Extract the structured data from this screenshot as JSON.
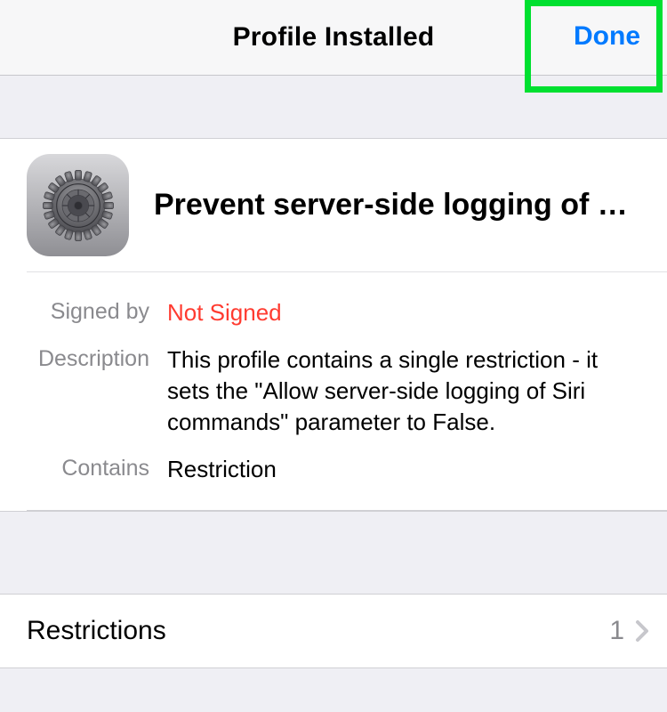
{
  "navbar": {
    "title": "Profile Installed",
    "done_label": "Done"
  },
  "profile": {
    "title": "Prevent server-side logging of Si...",
    "icon_name": "settings-gear-icon"
  },
  "details": {
    "signed_by_label": "Signed by",
    "signed_by_value": "Not Signed",
    "description_label": "Description",
    "description_value": "This profile contains a single restriction - it sets the \"Allow server-side logging of Siri commands\" parameter to False.",
    "contains_label": "Contains",
    "contains_value": "Restriction"
  },
  "restrictions": {
    "label": "Restrictions",
    "count": "1"
  }
}
